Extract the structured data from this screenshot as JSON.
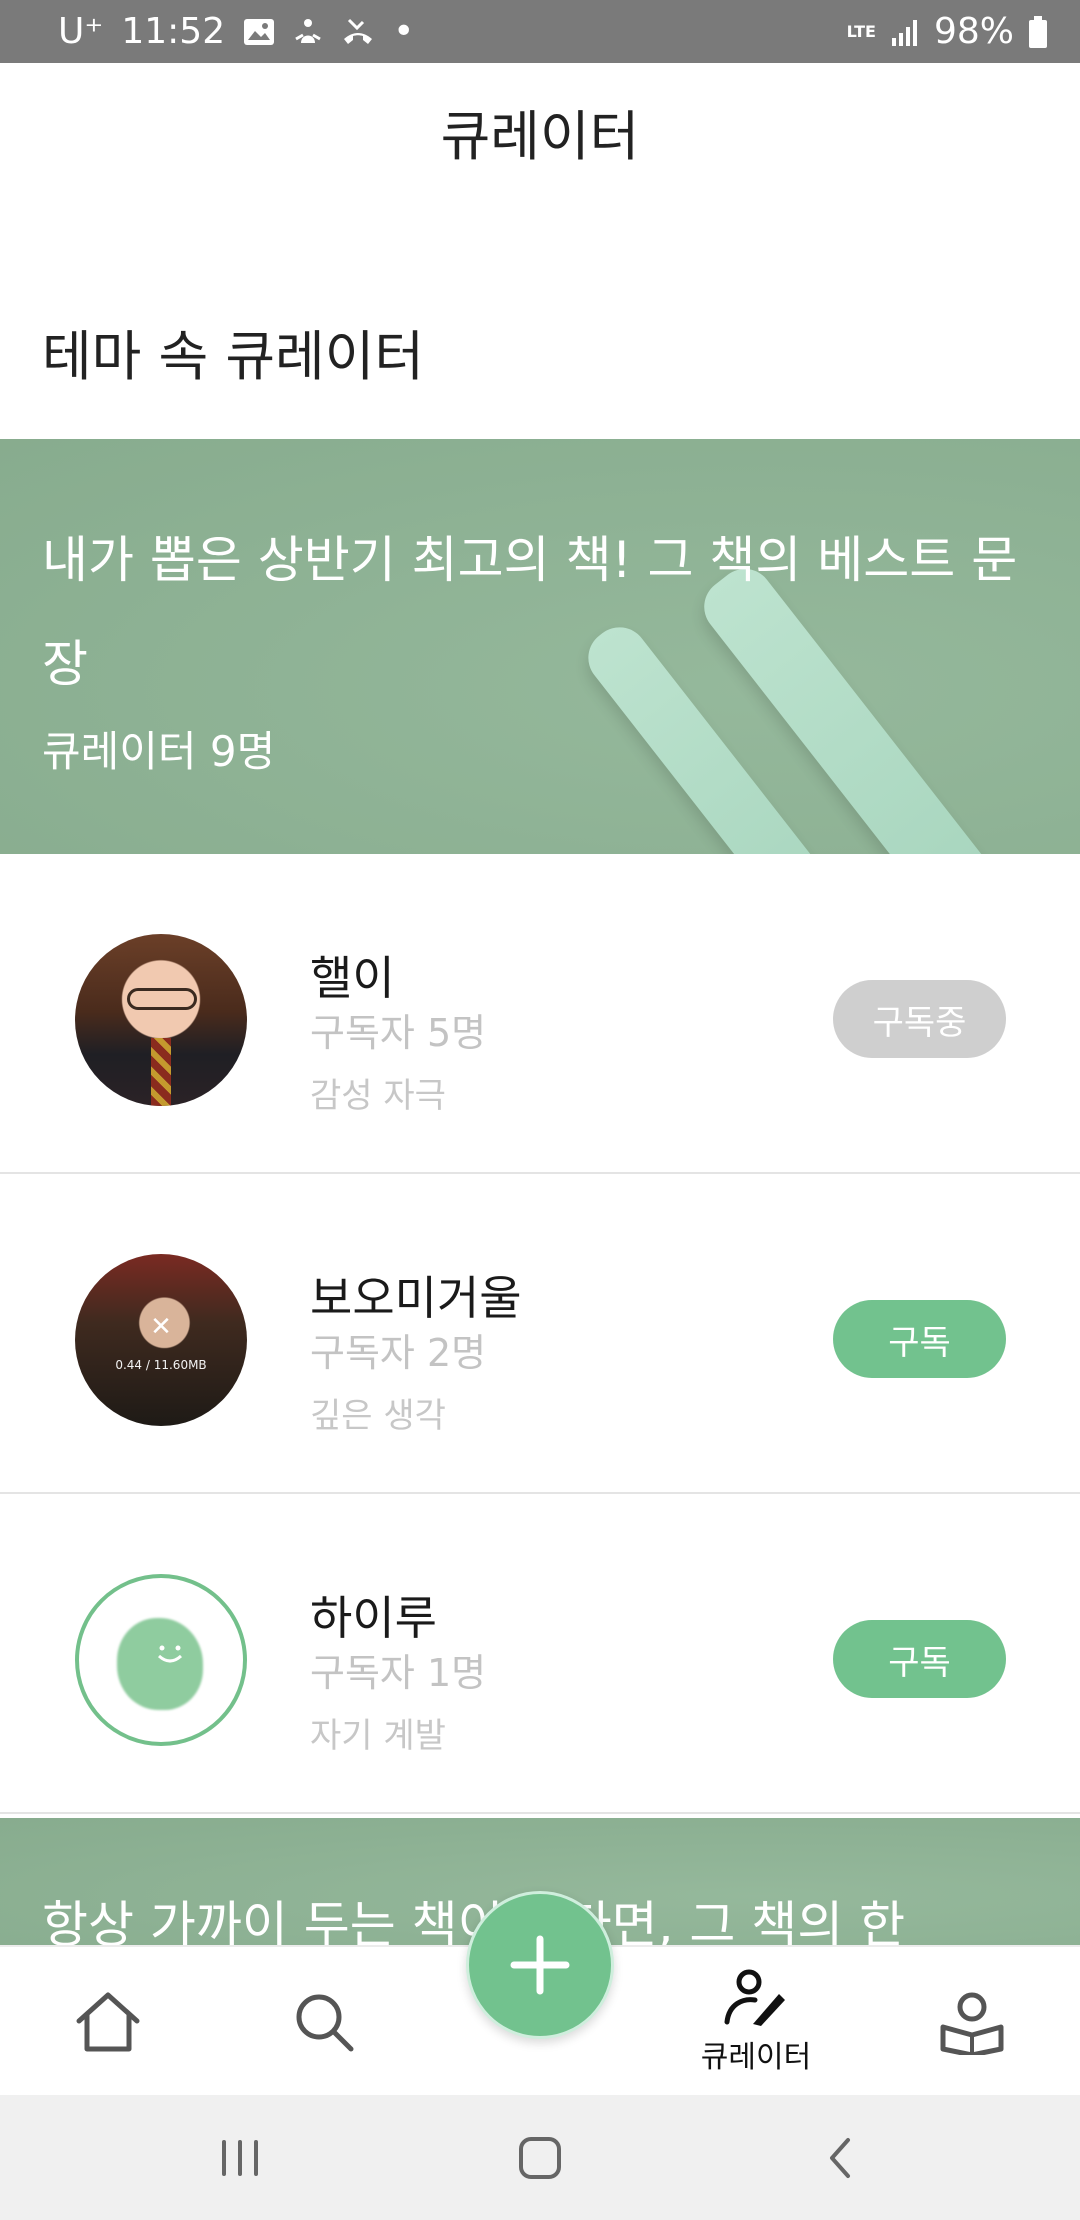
{
  "status_bar": {
    "carrier": "U⁺",
    "time": "11:52",
    "network": "LTE",
    "battery": "98%"
  },
  "header": {
    "title": "큐레이터"
  },
  "section": {
    "title": "테마 속 큐레이터"
  },
  "themes": [
    {
      "title": "내가 뽑은 상반기 최고의 책! 그 책의 베스트 문장",
      "curator_count": "큐레이터 9명"
    },
    {
      "title": "항상 가까이 두는 책이 있다면, 그 책의 한"
    }
  ],
  "curators": [
    {
      "name": "핼이",
      "subscribers": "구독자 5명",
      "tag": "감성 자극",
      "button": "구독중",
      "subscribed": true
    },
    {
      "name": "보오미거울",
      "subscribers": "구독자 2명",
      "tag": "깊은 생각",
      "button": "구독",
      "subscribed": false,
      "avatar_overlay": "0.44 / 11.60MB"
    },
    {
      "name": "하이루",
      "subscribers": "구독자 1명",
      "tag": "자기 계발",
      "button": "구독",
      "subscribed": false
    }
  ],
  "bottom_nav": {
    "items": [
      {
        "icon": "home-icon"
      },
      {
        "icon": "search-icon"
      },
      {
        "icon": "curator-icon",
        "label": "큐레이터",
        "active": true
      },
      {
        "icon": "my-library-icon"
      }
    ],
    "fab_icon": "plus-icon"
  },
  "colors": {
    "accent": "#72c28e",
    "banner": "#8db394",
    "subscribed_button": "#cfcfcf",
    "status_bar": "#7a7a7a"
  }
}
